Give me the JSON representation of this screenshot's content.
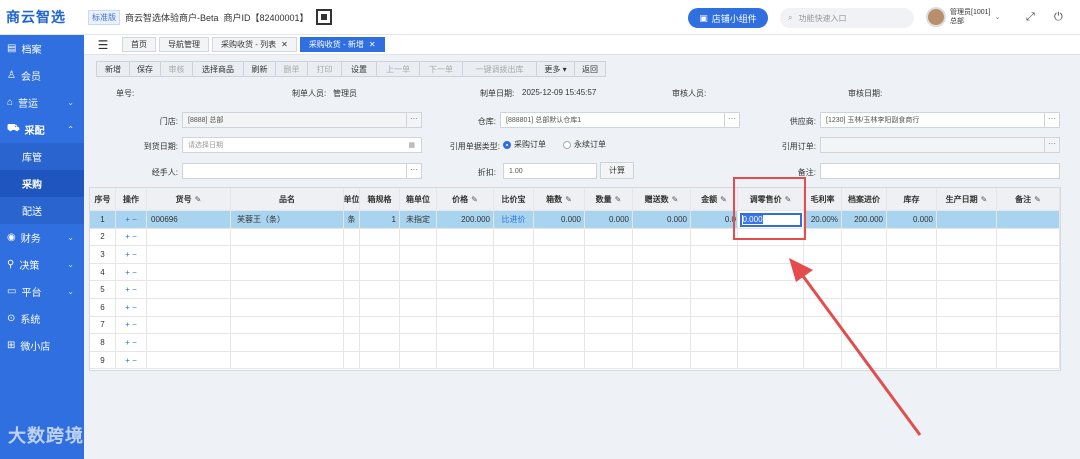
{
  "topbar": {
    "logo": "商云智选",
    "edition": "标准版",
    "merchant": "商云智选体验商户-Beta",
    "merchant_id": "商户ID【82400001】",
    "shop_widget": "店铺小组件",
    "quick_placeholder": "功能快速入口",
    "user_name": "管理员[1001]",
    "user_org": "总部"
  },
  "sidebar": {
    "items": [
      {
        "label": "档案",
        "icon": "archive-icon"
      },
      {
        "label": "会员",
        "icon": "user-icon"
      },
      {
        "label": "营运",
        "icon": "shop-icon"
      },
      {
        "label": "采配",
        "icon": "cart-icon"
      },
      {
        "label": "库管",
        "sub": true
      },
      {
        "label": "采购",
        "sub": true,
        "active": true
      },
      {
        "label": "配送",
        "sub": true
      },
      {
        "label": "财务",
        "icon": "finance-icon"
      },
      {
        "label": "决策",
        "icon": "decision-icon"
      },
      {
        "label": "平台",
        "icon": "platform-icon"
      },
      {
        "label": "系统",
        "icon": "system-icon"
      },
      {
        "label": "微小店",
        "icon": "mini-shop-icon"
      }
    ],
    "watermark": "大数跨境"
  },
  "tabs": [
    {
      "label": "首页"
    },
    {
      "label": "导航管理"
    },
    {
      "label": "采购收货 - 列表",
      "close": "✕"
    },
    {
      "label": "采购收货 - 新增",
      "close": "✕",
      "active": true
    }
  ],
  "toolbar": [
    {
      "label": "新增"
    },
    {
      "label": "保存"
    },
    {
      "label": "审核",
      "disabled": true
    },
    {
      "label": "选择商品"
    },
    {
      "label": "刷新"
    },
    {
      "label": "删单",
      "disabled": true
    },
    {
      "label": "打印",
      "disabled": true
    },
    {
      "label": "设置"
    },
    {
      "label": "上一单",
      "disabled": true
    },
    {
      "label": "下一单",
      "disabled": true
    },
    {
      "label": "一键调拨出库",
      "disabled": true
    },
    {
      "label": "更多 ▾"
    },
    {
      "label": "返回"
    }
  ],
  "info": {
    "order_no_label": "单号:",
    "creator_label": "制单人员:",
    "creator": "管理员",
    "create_date_label": "制单日期:",
    "create_date": "2025-12-09 15:45:57",
    "auditor_label": "审核人员:",
    "audit_date_label": "审核日期:"
  },
  "form": {
    "store_label": "门店:",
    "store": "[8888] 总部",
    "warehouse_label": "仓库:",
    "warehouse": "[888801] 总部默认仓库1",
    "supplier_label": "供应商:",
    "supplier": "[1230] 玉林/玉林李阳副食商行",
    "arrival_label": "到货日期:",
    "arrival_placeholder": "请选择日期",
    "ref_type_label": "引用单据类型:",
    "ref_opt1": "采购订单",
    "ref_opt2": "永续订单",
    "ref_order_label": "引用订单:",
    "handler_label": "经手人:",
    "discount_label": "折扣:",
    "discount": "1.00",
    "calc_label": "计算",
    "remark_label": "备注:"
  },
  "grid": {
    "columns": [
      {
        "label": "序号"
      },
      {
        "label": "操作"
      },
      {
        "label": "货号",
        "edit": "✎"
      },
      {
        "label": "品名"
      },
      {
        "label": "单位"
      },
      {
        "label": "箱规格"
      },
      {
        "label": "箱单位"
      },
      {
        "label": "价格",
        "edit": "✎"
      },
      {
        "label": "比价宝"
      },
      {
        "label": "箱数",
        "edit": "✎"
      },
      {
        "label": "数量",
        "edit": "✎"
      },
      {
        "label": "赠送数",
        "edit": "✎"
      },
      {
        "label": "金额",
        "edit": "✎"
      },
      {
        "label": "调零售价",
        "edit": "✎"
      },
      {
        "label": "毛利率"
      },
      {
        "label": "档案进价"
      },
      {
        "label": "库存"
      },
      {
        "label": "生产日期",
        "edit": "✎"
      },
      {
        "label": "备注",
        "edit": "✎"
      }
    ],
    "rows": [
      {
        "n": "1",
        "ops": "+ −",
        "code": "000696",
        "name": "芙蓉王（条）",
        "unit": "条",
        "spec": "1",
        "box_unit": "未指定",
        "price": "200.000",
        "compare": "比进价",
        "boxes": "0.000",
        "qty": "0.000",
        "gift": "0.000",
        "amount": "0.0",
        "retail_input": "0.000",
        "margin": "20.00%",
        "cost": "200.000",
        "stock": "0.000",
        "prod_date": "",
        "remark": ""
      },
      {
        "n": "2",
        "ops": "+ −"
      },
      {
        "n": "3",
        "ops": "+ −"
      },
      {
        "n": "4",
        "ops": "+ −"
      },
      {
        "n": "5",
        "ops": "+ −"
      },
      {
        "n": "6",
        "ops": "+ −"
      },
      {
        "n": "7",
        "ops": "+ −"
      },
      {
        "n": "8",
        "ops": "+ −"
      },
      {
        "n": "9",
        "ops": "+ −"
      }
    ]
  }
}
